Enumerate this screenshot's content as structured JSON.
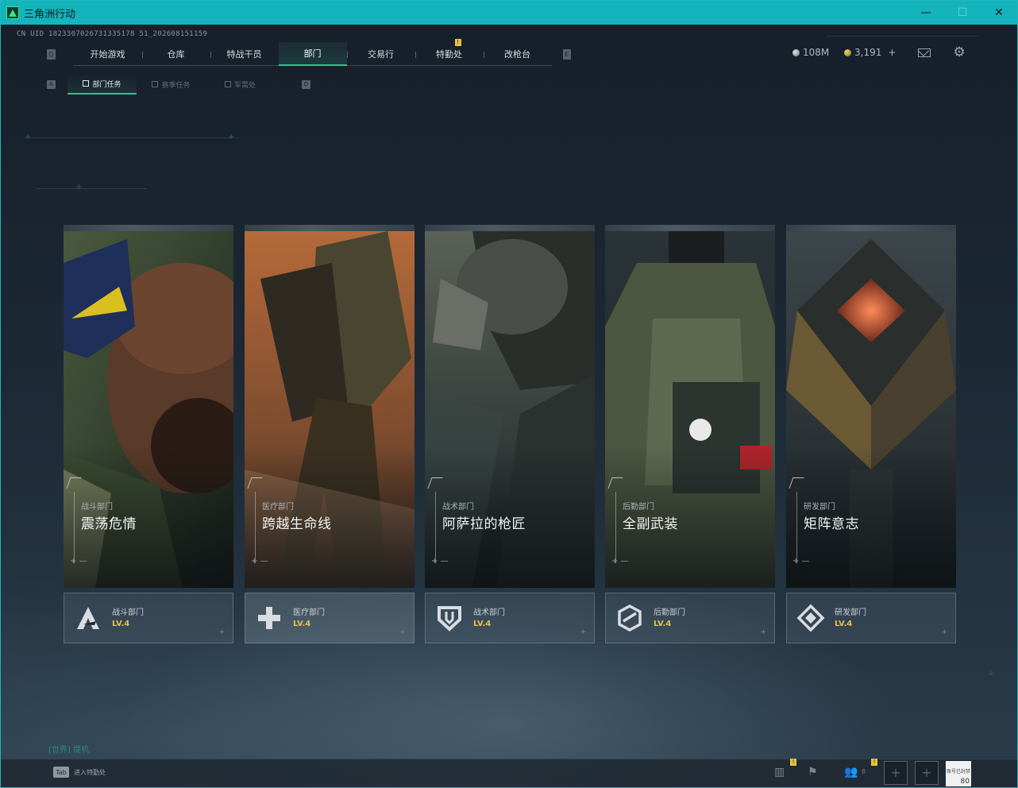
{
  "window": {
    "title": "三角洲行动",
    "minimize": "—",
    "maximize": "☐",
    "close": "✕"
  },
  "uid": "CN UID 1823307026731335178 51_202608151159",
  "nav": {
    "left_key": "Q",
    "right_key": "E",
    "tabs": [
      {
        "label": "开始游戏"
      },
      {
        "label": "仓库"
      },
      {
        "label": "特战干员"
      },
      {
        "label": "部门",
        "active": true
      },
      {
        "label": "交易行"
      },
      {
        "label": "特勤处",
        "badge": "!"
      },
      {
        "label": "改枪台"
      }
    ]
  },
  "subnav": {
    "left_key": "A",
    "right_key": "D",
    "tabs": [
      {
        "label": "部门任务",
        "active": true
      },
      {
        "label": "赛季任务"
      },
      {
        "label": "军需处"
      }
    ]
  },
  "currency": {
    "silver": "108M",
    "gold": "3,191",
    "add": "+"
  },
  "cards": [
    {
      "sub": "战斗部门",
      "title": "震荡危情",
      "dept": "战斗部门",
      "level": "LV.4",
      "icon": "combat-a-icon"
    },
    {
      "sub": "医疗部门",
      "title": "跨越生命线",
      "dept": "医疗部门",
      "level": "LV.4",
      "icon": "medical-cross-icon"
    },
    {
      "sub": "战术部门",
      "title": "阿萨拉的枪匠",
      "dept": "战术部门",
      "level": "LV.4",
      "icon": "tactical-shield-icon"
    },
    {
      "sub": "后勤部门",
      "title": "全副武装",
      "dept": "后勤部门",
      "level": "LV.4",
      "icon": "logistics-hex-icon"
    },
    {
      "sub": "研发部门",
      "title": "矩阵意志",
      "dept": "研发部门",
      "level": "LV.4",
      "icon": "research-diamond-icon"
    }
  ],
  "chat": {
    "label": "[世界] 提机"
  },
  "bottom": {
    "tab_key": "Tab",
    "tab_hint": "进入特勤处",
    "friends_count": "8",
    "badge": "!",
    "avatar_text": "账号已封禁",
    "avatar_level": "80"
  }
}
